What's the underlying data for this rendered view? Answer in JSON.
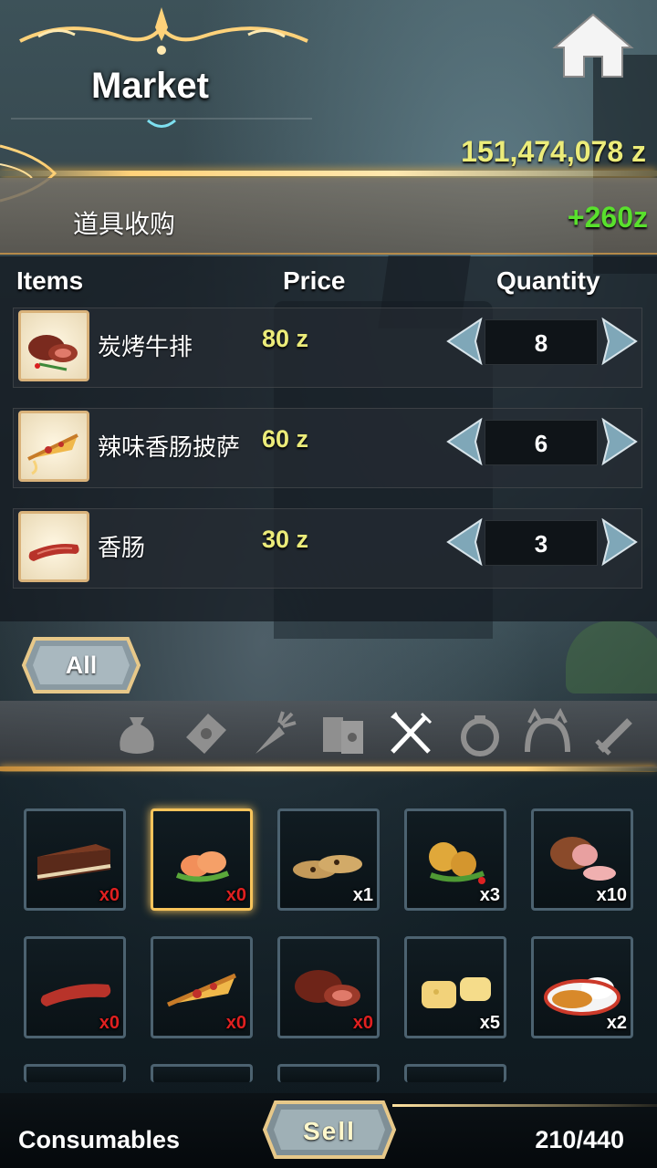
{
  "header": {
    "title": "Market",
    "zeny": "151,474,078 z",
    "home_icon": "home-icon"
  },
  "buy_panel": {
    "label": "道具收购",
    "total": "+260z"
  },
  "table": {
    "columns": [
      "Items",
      "Price",
      "Quantity"
    ],
    "rows": [
      {
        "name": "炭烤牛排",
        "price": "80 z",
        "quantity": "8",
        "icon": "grilled-steak-icon"
      },
      {
        "name": "辣味香肠披萨",
        "price": "60 z",
        "quantity": "6",
        "icon": "pizza-slice-icon"
      },
      {
        "name": "香肠",
        "price": "30 z",
        "quantity": "3",
        "icon": "sausage-icon"
      }
    ]
  },
  "filter": {
    "all_label": "All"
  },
  "categories": [
    {
      "icon": "bag-icon"
    },
    {
      "icon": "card-icon"
    },
    {
      "icon": "carrot-icon"
    },
    {
      "icon": "book-icon"
    },
    {
      "icon": "fork-knife-icon",
      "active": true
    },
    {
      "icon": "ring-icon"
    },
    {
      "icon": "headband-icon"
    },
    {
      "icon": "sword-icon"
    }
  ],
  "inventory": [
    {
      "icon": "cake-icon",
      "count": "x0"
    },
    {
      "icon": "shrimp-roll-icon",
      "count": "x0",
      "selected": true
    },
    {
      "icon": "cookies-icon",
      "count": "x1"
    },
    {
      "icon": "fried-chicken-icon",
      "count": "x3"
    },
    {
      "icon": "ham-icon",
      "count": "x10"
    },
    {
      "icon": "sausage-icon",
      "count": "x0"
    },
    {
      "icon": "pizza-slice-icon",
      "count": "x0"
    },
    {
      "icon": "grilled-steak-icon",
      "count": "x0"
    },
    {
      "icon": "cheese-icon",
      "count": "x5"
    },
    {
      "icon": "curry-rice-icon",
      "count": "x2"
    }
  ],
  "footer": {
    "category": "Consumables",
    "sell_label": "Sell",
    "capacity": "210/440"
  },
  "colors": {
    "gold": "#ffd27a",
    "price_yellow": "#ecec7a",
    "gain_green": "#59e02d",
    "zero_red": "#e02020"
  }
}
